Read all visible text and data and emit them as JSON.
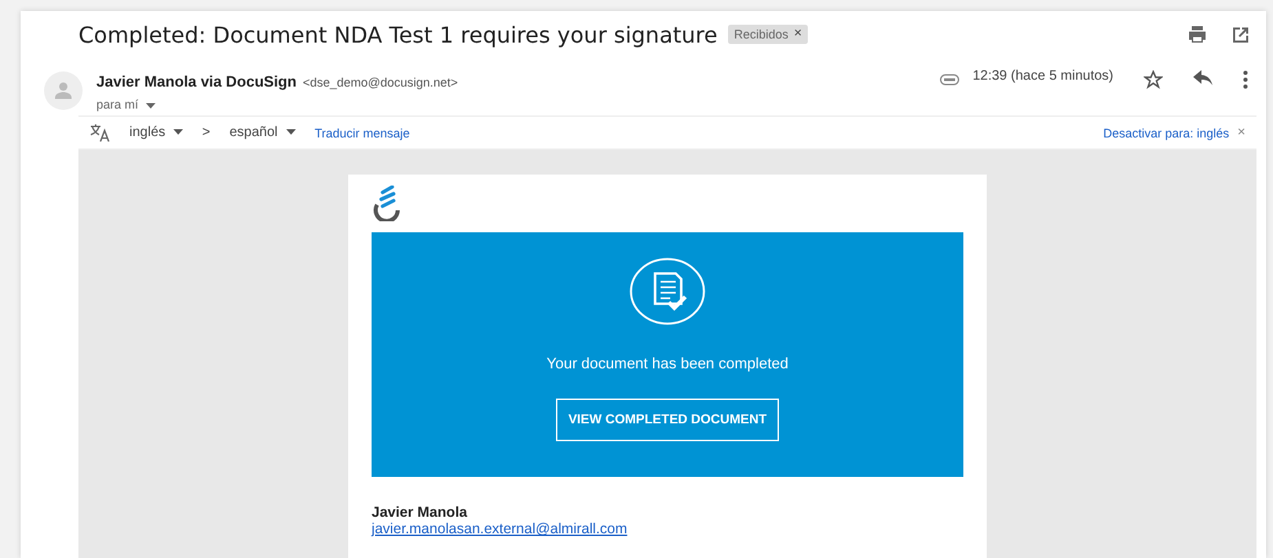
{
  "subject": "Completed: Document NDA Test 1 requires your signature",
  "label": {
    "text": "Recibidos",
    "close": "×"
  },
  "sender": {
    "name": "Javier Manola via DocuSign",
    "email": "<dse_demo@docusign.net>",
    "to": "para mí",
    "time": "12:39 (hace 5 minutos)"
  },
  "translate": {
    "from": "inglés",
    "arrow": ">",
    "to": "español",
    "action": "Traducir mensaje",
    "disable": "Desactivar para: inglés",
    "close": "×"
  },
  "email": {
    "message": "Your document has been completed",
    "button": "VIEW COMPLETED DOCUMENT",
    "signer_name": "Javier Manola",
    "signer_email": "javier.manolasan.external@almirall.com"
  }
}
